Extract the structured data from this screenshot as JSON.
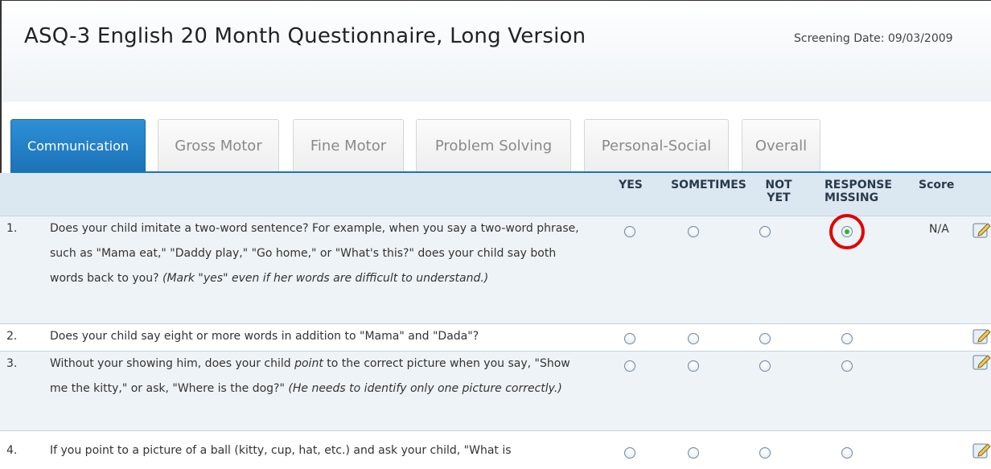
{
  "header": {
    "title": "ASQ-3 English 20 Month Questionnaire, Long Version",
    "screening_date": "Screening Date: 09/03/2009"
  },
  "tabs": [
    {
      "label": "Communication",
      "active": true
    },
    {
      "label": "Gross Motor",
      "active": false
    },
    {
      "label": "Fine Motor",
      "active": false
    },
    {
      "label": "Problem Solving",
      "active": false
    },
    {
      "label": "Personal-Social",
      "active": false
    },
    {
      "label": "Overall",
      "active": false
    }
  ],
  "columns": {
    "yes": "YES",
    "sometimes": "SOMETIMES",
    "not_yet_1": "NOT",
    "not_yet_2": "YET",
    "missing_1": "RESPONSE",
    "missing_2": "MISSING",
    "score": "Score"
  },
  "questions": [
    {
      "num": "1.",
      "text": "Does your child imitate a two-word sentence? For example, when you say a two-word phrase, such as \"Mama eat,\" \"Daddy play,\" \"Go home,\" or \"What's this?\" does your child say both words back to you?",
      "note": "(Mark \"yes\" even if her words are difficult to understand.)",
      "selected": "response_missing",
      "score": "N/A"
    },
    {
      "num": "2.",
      "text": "Does your child say eight or more words in addition to \"Mama\" and \"Dada\"?",
      "selected": null,
      "score": ""
    },
    {
      "num": "3.",
      "text_a": "Without your showing him, does your child ",
      "text_em": "point",
      "text_b": " to the correct picture when you say, \"Show me the kitty,\" or ask, \"Where is the dog?\" ",
      "note": "(He needs to identify only one picture correctly.)",
      "selected": null,
      "score": ""
    },
    {
      "num": "4.",
      "text": "If you point to a picture of a ball (kitty, cup, hat, etc.) and ask your child, \"What is",
      "selected": null,
      "score": ""
    }
  ],
  "colors": {
    "active_tab": "#1c73b8",
    "header_band": "#dbe8f2",
    "selected_radio": "#2bb52b",
    "highlight": "#e00000"
  },
  "icons": {
    "edit": "edit-note-icon"
  }
}
